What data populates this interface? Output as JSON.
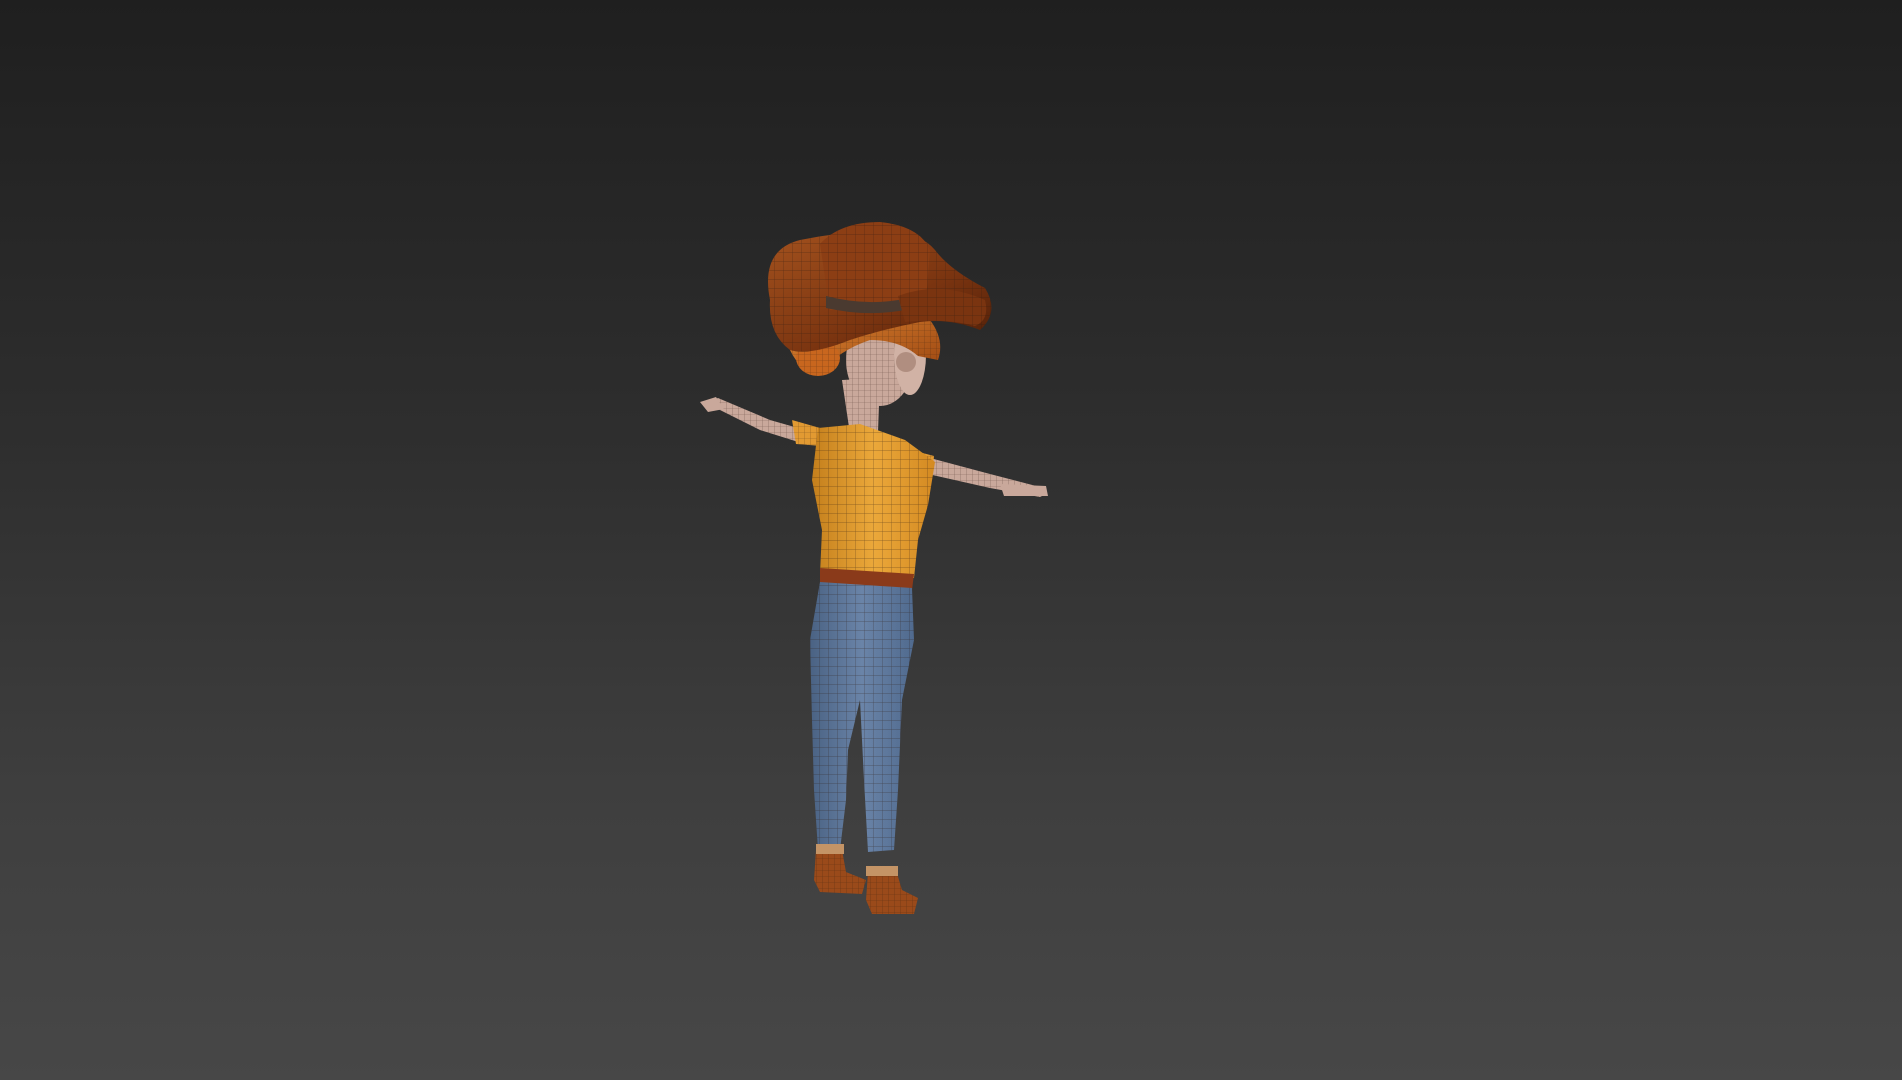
{
  "viewport": {
    "background_top": "#1f1f1f",
    "background_bottom": "#474747"
  },
  "model": {
    "hat_color": "#8a3e12",
    "hair_color": "#c8661e",
    "shirt_color": "#e8a030",
    "pants_color": "#5a7396",
    "skin_color": "#c8a89a",
    "boot_color": "#9a4a1a",
    "wire_color": "#2a1a10"
  }
}
